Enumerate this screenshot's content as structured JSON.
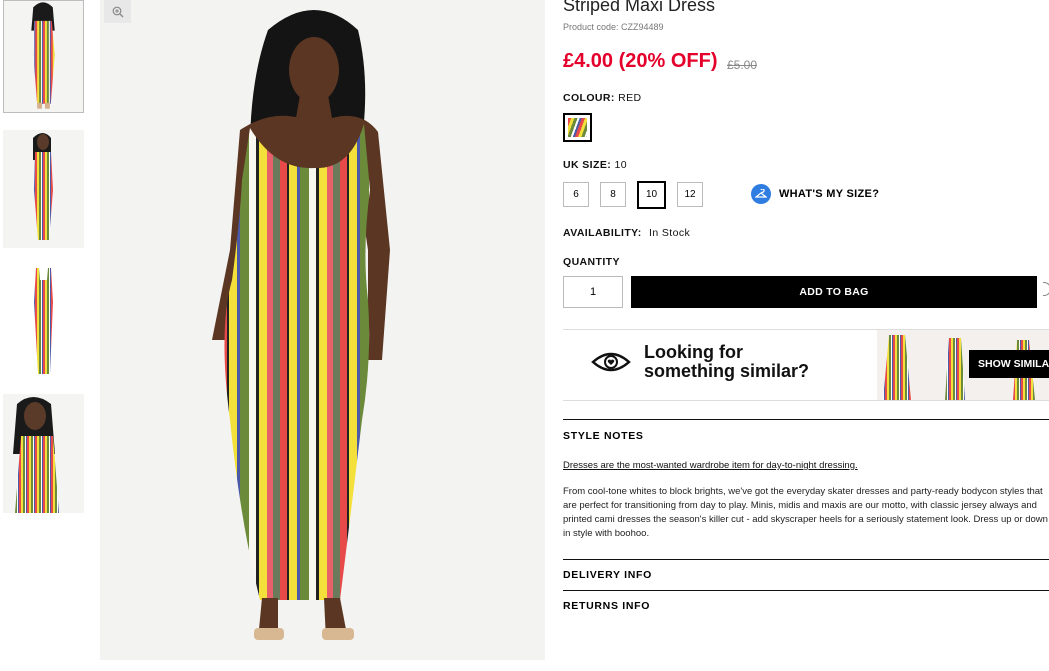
{
  "product": {
    "title": "Striped Maxi Dress",
    "code": "Product code: CZZ94489",
    "price": "£4.00 (20% OFF)",
    "was_price": "£5.00"
  },
  "colour": {
    "label": "COLOUR:",
    "value": "RED"
  },
  "size": {
    "label": "UK SIZE:",
    "value": "10",
    "options": [
      "6",
      "8",
      "10",
      "12"
    ],
    "guide_label": "WHAT'S MY SIZE?"
  },
  "availability": {
    "label": "AVAILABILITY:",
    "value": "In Stock"
  },
  "quantity": {
    "label": "QUANTITY",
    "value": "1"
  },
  "add_to_bag": "ADD TO BAG",
  "similar": {
    "line1": "Looking for",
    "line2": "something similar?",
    "button": "SHOW SIMILAR"
  },
  "style_notes": {
    "heading": "STYLE NOTES",
    "link": "Dresses are the most-wanted wardrobe item for day-to-night dressing.",
    "body": "From cool-tone whites to block brights, we've got the everyday skater dresses and party-ready bodycon styles that are perfect for transitioning from day to play. Minis, midis and maxis are our motto, with classic jersey always and printed cami dresses the season's killer cut - add skyscraper heels for a seriously statement look. Dress up or down in style with boohoo."
  },
  "delivery_info": "DELIVERY INFO",
  "returns_info": "RETURNS INFO",
  "colors": {
    "sale_red": "#e4002b",
    "primary_black": "#000000",
    "info_blue": "#2f7de1"
  }
}
